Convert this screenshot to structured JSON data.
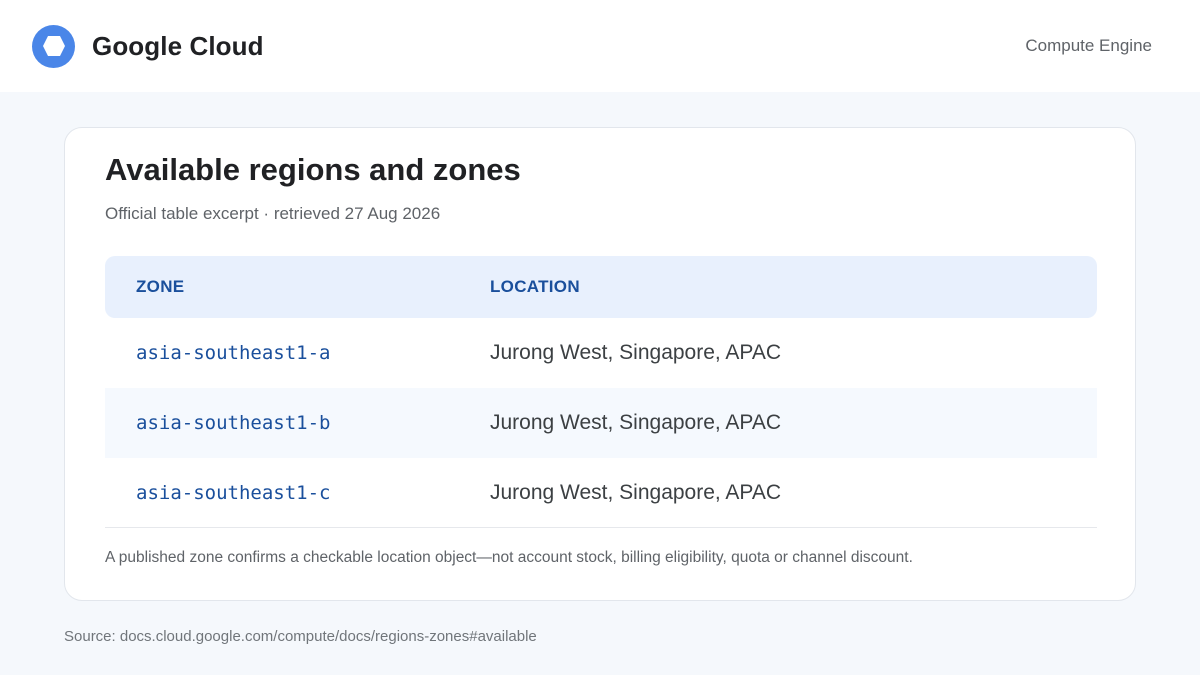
{
  "header": {
    "brand": "Google Cloud",
    "product": "Compute Engine",
    "logo_icon": "google-cloud-hexagon-icon",
    "logo_color": "#4a86e8"
  },
  "card": {
    "title": "Available regions and zones",
    "subtitle": "Official table excerpt · retrieved 27 Aug 2026",
    "table": {
      "columns": [
        "ZONE",
        "LOCATION"
      ],
      "rows": [
        {
          "zone": "asia-southeast1-a",
          "location": "Jurong West, Singapore, APAC"
        },
        {
          "zone": "asia-southeast1-b",
          "location": "Jurong West, Singapore, APAC"
        },
        {
          "zone": "asia-southeast1-c",
          "location": "Jurong West, Singapore, APAC"
        }
      ]
    },
    "note": "A published zone confirms a checkable location object—not account stock, billing eligibility, quota or channel discount."
  },
  "source": "Source: docs.cloud.google.com/compute/docs/regions-zones#available",
  "colors": {
    "accent": "#1a4f9c",
    "header_bg": "#e8f0fd"
  }
}
